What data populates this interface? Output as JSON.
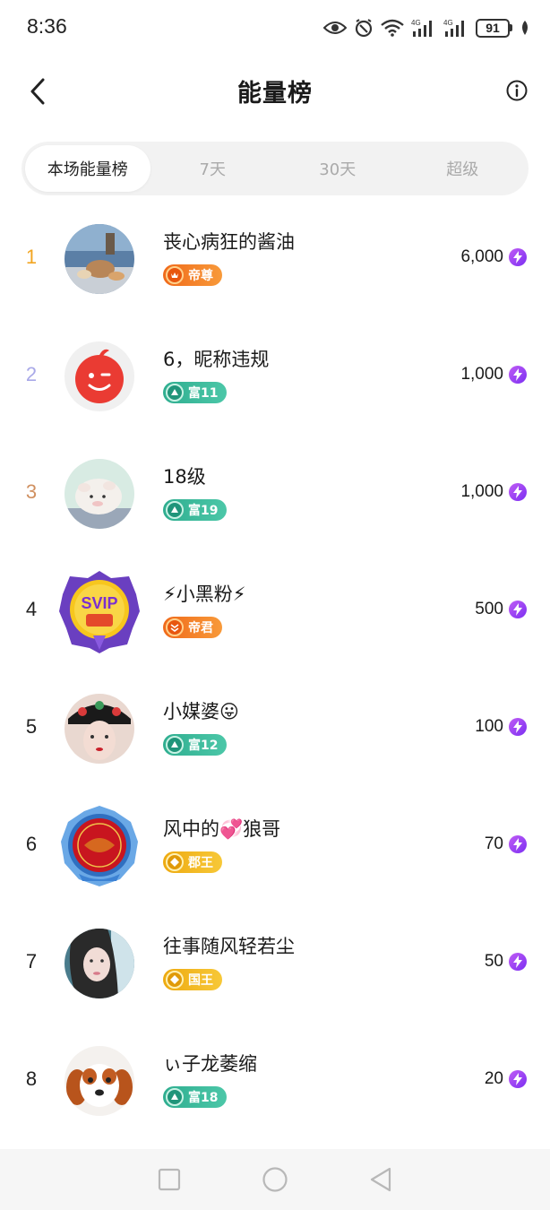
{
  "status_bar": {
    "time": "8:36",
    "battery": "91"
  },
  "header": {
    "title": "能量榜",
    "back_icon": "chevron-left-icon",
    "info_icon": "info-circle-icon"
  },
  "tabs": [
    {
      "label": "本场能量榜",
      "active": true
    },
    {
      "label": "7天",
      "active": false
    },
    {
      "label": "30天",
      "active": false
    },
    {
      "label": "超级",
      "active": false
    }
  ],
  "ranking": [
    {
      "rank": "1",
      "name": "丧心病狂的酱油",
      "badge": "帝尊",
      "badge_type": "orange",
      "score": "6,000",
      "rank_color": "#f2a623"
    },
    {
      "rank": "2",
      "name": "6，昵称违规",
      "badge": "富11",
      "badge_type": "green",
      "score": "1,000",
      "rank_color": "#a9a9e8"
    },
    {
      "rank": "3",
      "name": "18级",
      "badge": "富19",
      "badge_type": "green",
      "score": "1,000",
      "rank_color": "#d09060"
    },
    {
      "rank": "4",
      "name": "⚡小黑粉⚡",
      "badge": "帝君",
      "badge_type": "orange",
      "score": "500",
      "rank_color": "#222222"
    },
    {
      "rank": "5",
      "name": "小媒婆😛",
      "badge": "富12",
      "badge_type": "green",
      "score": "100",
      "rank_color": "#222222"
    },
    {
      "rank": "6",
      "name": "风中的💞狼哥",
      "badge": "郡王",
      "badge_type": "gold",
      "score": "70",
      "rank_color": "#222222"
    },
    {
      "rank": "7",
      "name": "往事随风轻若尘",
      "badge": "国王",
      "badge_type": "gold",
      "score": "50",
      "rank_color": "#222222"
    },
    {
      "rank": "8",
      "name": "ぃ子龙萎缩",
      "badge": "富18",
      "badge_type": "green",
      "score": "20",
      "rank_color": "#222222"
    }
  ],
  "colors": {
    "orange_badge": "#f5781e",
    "green_badge": "#3cb99a",
    "gold_badge": "#f2b81c",
    "energy": "#9b3ff0"
  }
}
